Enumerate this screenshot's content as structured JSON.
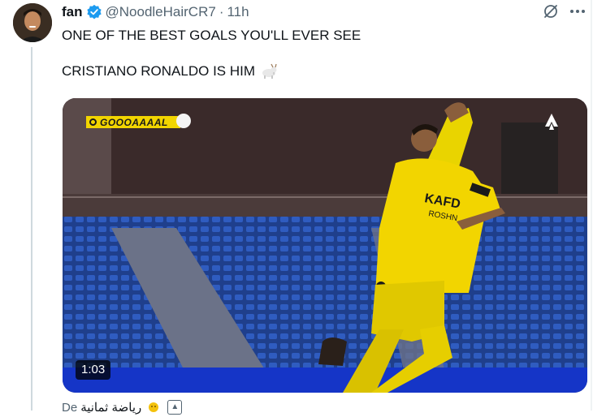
{
  "tweet": {
    "display_name": "fan",
    "handle": "@NoodleHairCR7",
    "separator": "·",
    "time": "11h",
    "text_line1": "ONE OF THE BEST GOALS YOU'LL EVER SEE",
    "text_line2": "CRISTIANO RONALDO IS HIM",
    "goat_emoji_icon": "goat-icon"
  },
  "media": {
    "banner_text": "GOOOAAAAL",
    "duration": "1:03",
    "channel_logo_icon": "channel-flame-logo-icon",
    "jersey_sponsor": "KAFD",
    "jersey_text2": "ROSHN"
  },
  "footer": {
    "prefix": "De",
    "sub_label": "رياضة ثمانية",
    "emoji_icon": "sun-face-icon",
    "button_icon": "caret-up-icon"
  },
  "colors": {
    "verified_blue": "#1d9bf0",
    "text_primary": "#0f1419",
    "text_secondary": "#536471",
    "jersey_yellow": "#f2d500"
  }
}
